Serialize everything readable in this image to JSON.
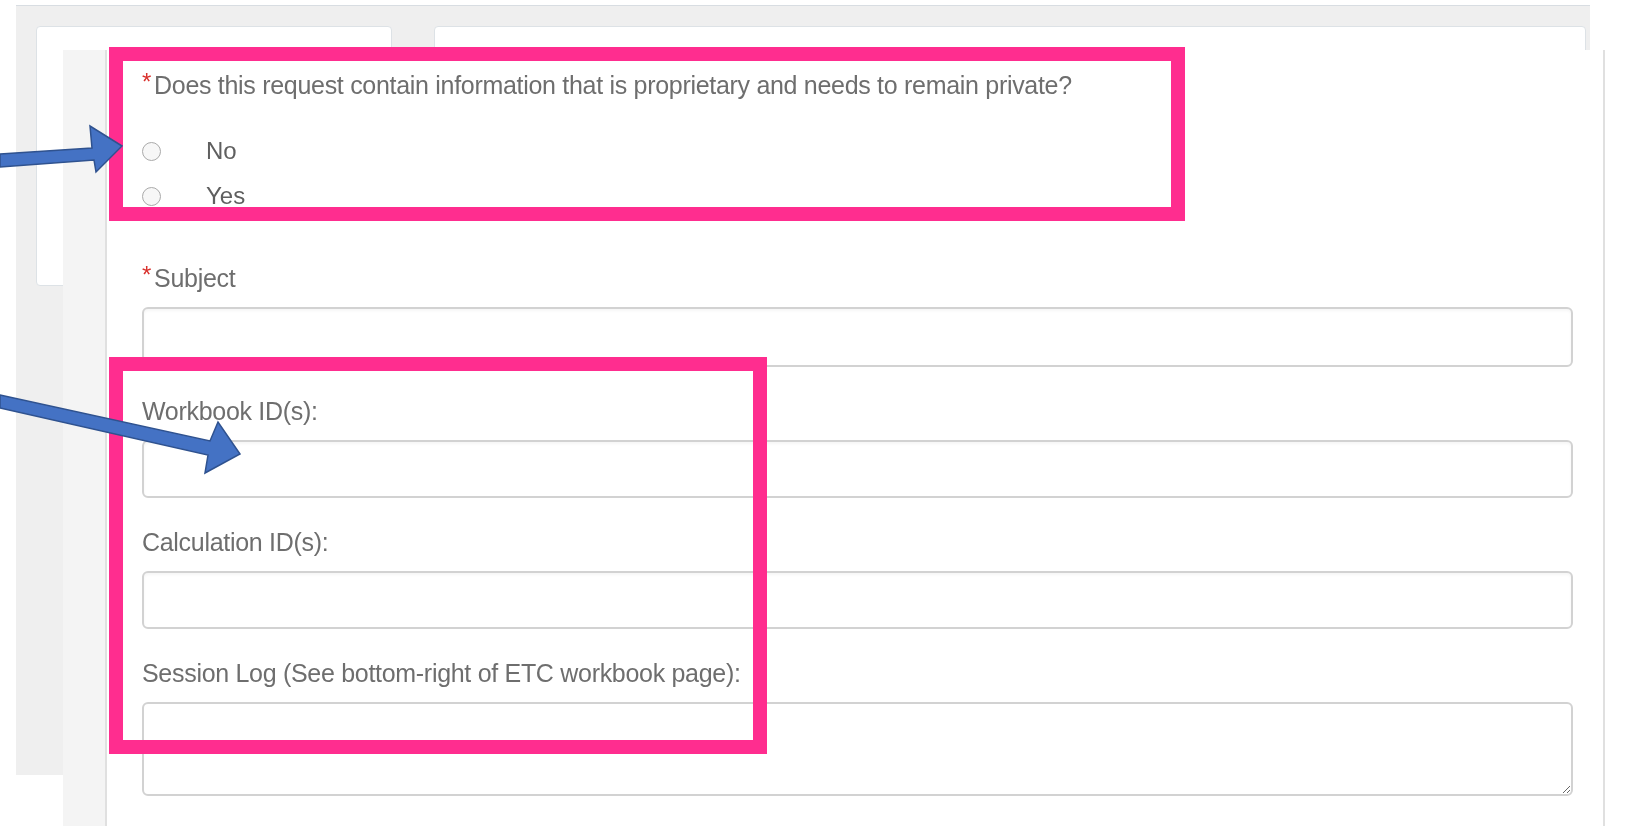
{
  "form": {
    "question": {
      "label": "Does this request contain information that is proprietary and needs to remain private?",
      "required_mark": "*",
      "options": [
        {
          "label": "No",
          "selected": false
        },
        {
          "label": "Yes",
          "selected": false
        }
      ]
    },
    "fields": [
      {
        "label": "Subject",
        "required_mark": "*",
        "kind": "input"
      },
      {
        "label": "Workbook ID(s):",
        "kind": "input"
      },
      {
        "label": "Calculation ID(s):",
        "kind": "input"
      },
      {
        "label": "Session Log (See bottom-right of ETC workbook page):",
        "kind": "textarea"
      }
    ]
  }
}
